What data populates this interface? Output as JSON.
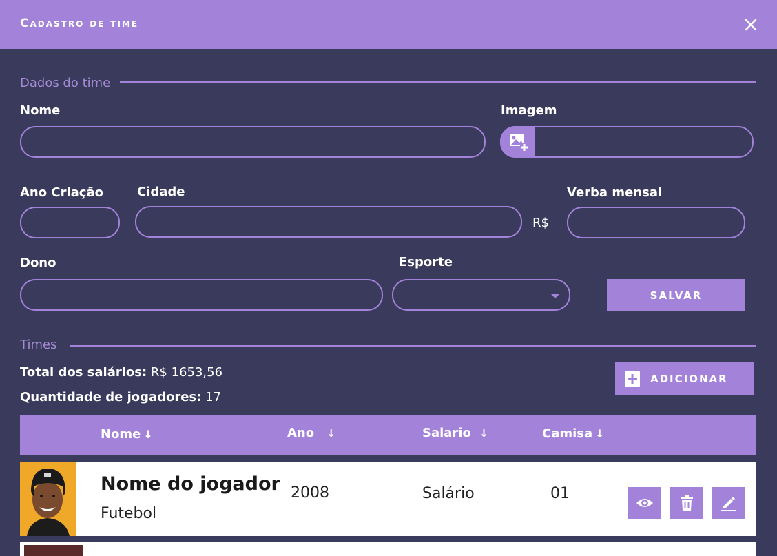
{
  "dialog": {
    "title": "Cadastro de time",
    "close_icon": "close-icon"
  },
  "form": {
    "section_label": "Dados do time",
    "nome_label": "Nome",
    "imagem_label": "Imagem",
    "image_icon": "add-image-icon",
    "ano_label": "Ano Criação",
    "cidade_label": "Cidade",
    "currency_symbol": "R$",
    "verba_label": "Verba mensal",
    "dono_label": "Dono",
    "esporte_label": "Esporte",
    "save_button": "SALVAR"
  },
  "teams": {
    "section_label": "Times",
    "total_salary_label": "Total dos salários:",
    "total_salary_value": "R$ 1653,56",
    "players_count_label": "Quantidade de jogadores:",
    "players_count_value": "17",
    "add_button": "ADICIONAR",
    "add_icon": "plus-square-icon"
  },
  "table": {
    "columns": [
      "Nome",
      "Ano",
      "Salario",
      "Camisa"
    ],
    "rows": [
      {
        "name": "Nome do jogador",
        "sport": "Futebol",
        "year": "2008",
        "salary": "Salário",
        "shirt": "01",
        "actions": [
          "eye-icon",
          "trash-icon",
          "edit-icon"
        ]
      }
    ]
  },
  "colors": {
    "accent": "#a383d9",
    "background": "#3a3a5c",
    "text": "#ffffff"
  }
}
